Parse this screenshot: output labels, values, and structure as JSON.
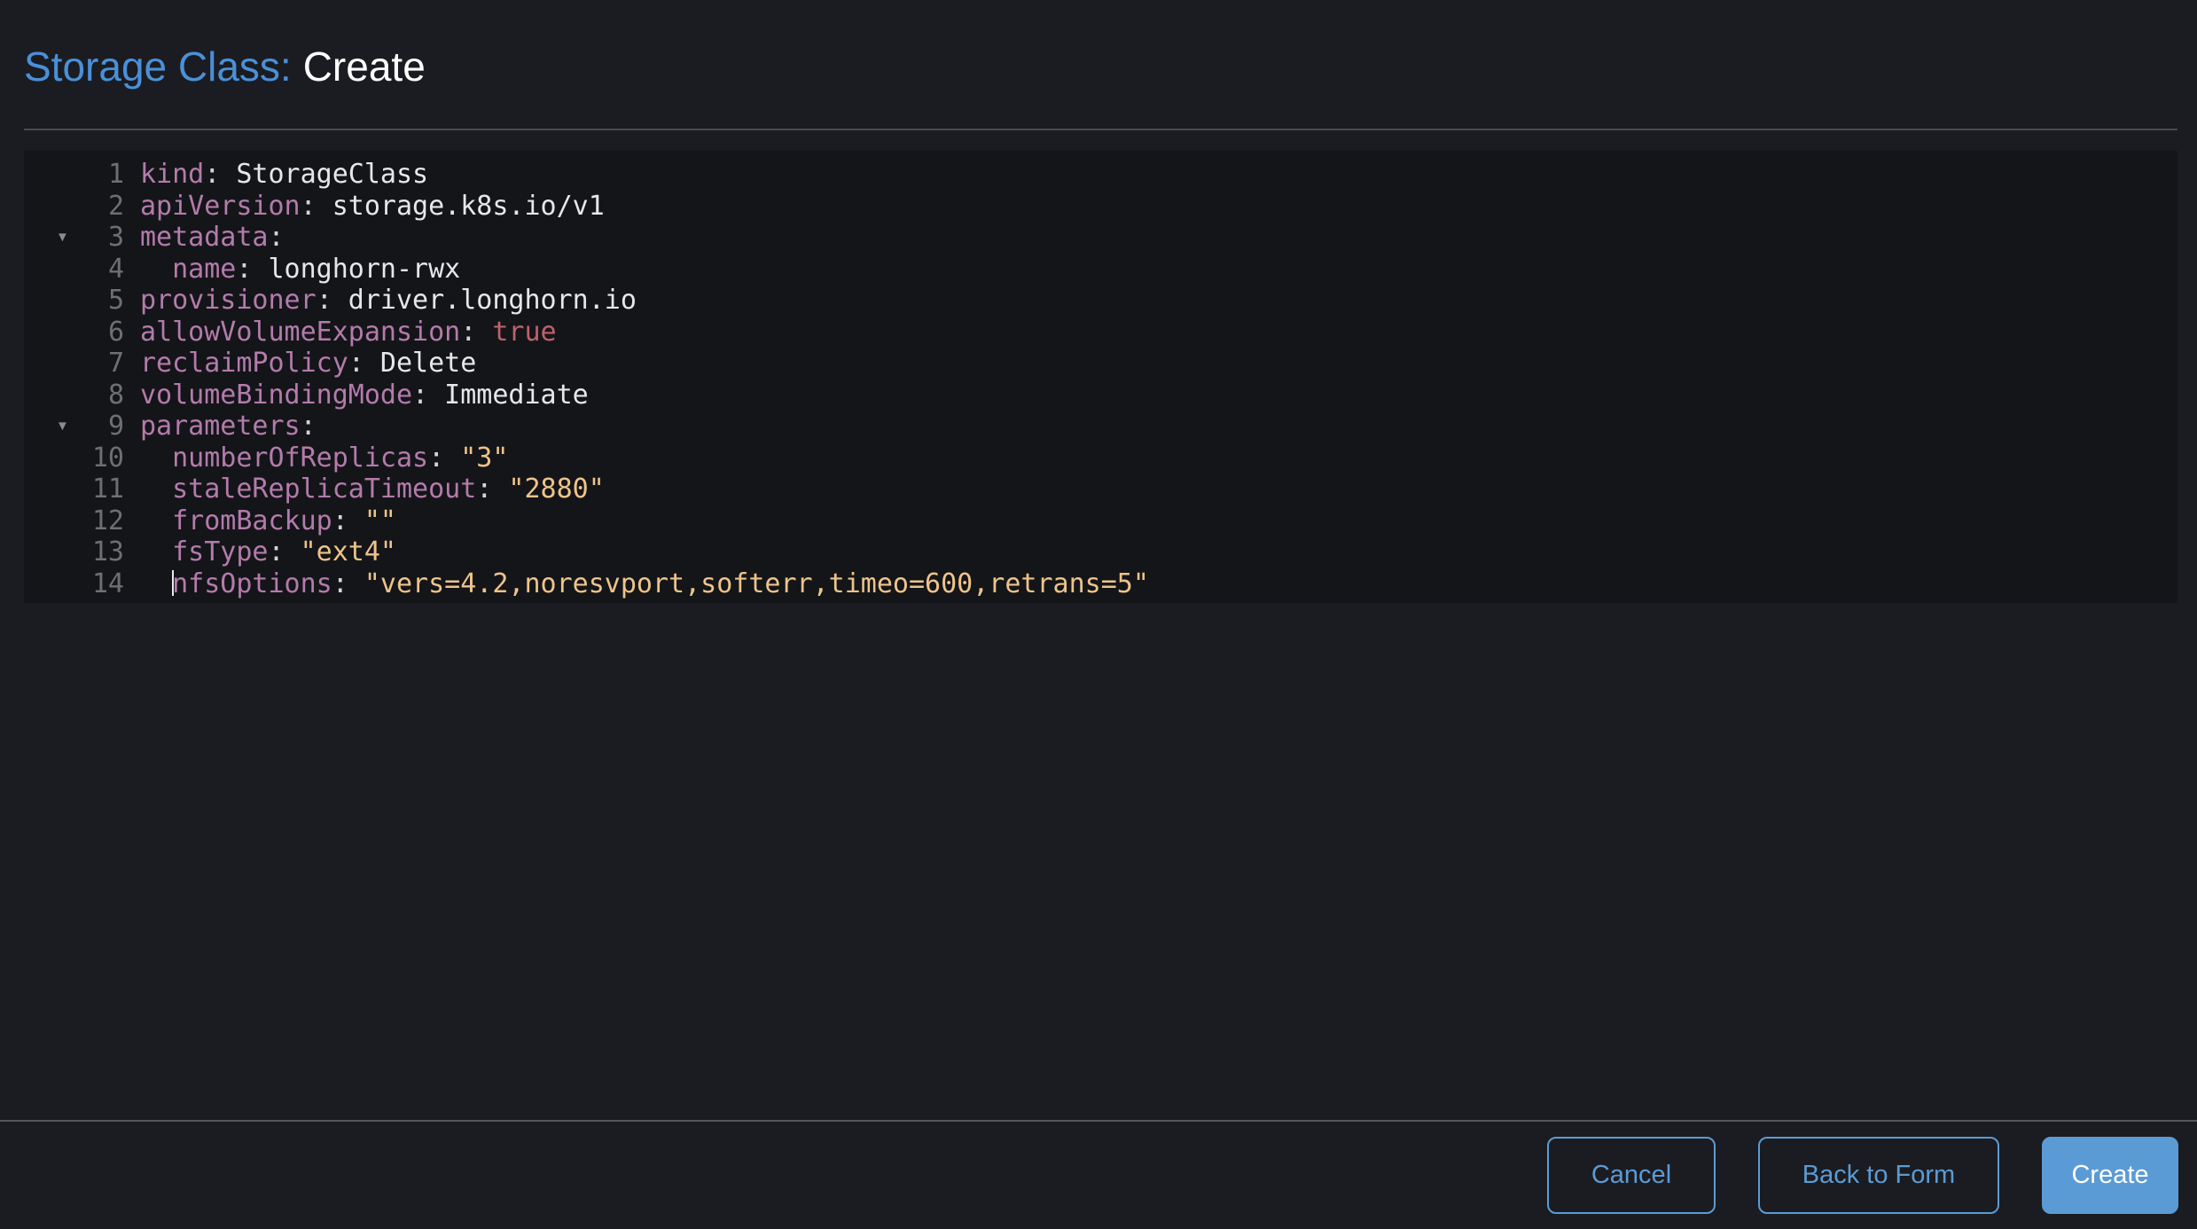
{
  "header": {
    "title_prefix": "Storage Class:",
    "title_action": "Create"
  },
  "colors": {
    "page_bg": "#1b1c21",
    "editor_bg": "#141519",
    "divider_top": "#4a4b50",
    "divider_bottom": "#55565b",
    "title_blue": "#4a90d8",
    "accent_blue": "#5b9bd5",
    "key": "#b37bab",
    "string": "#eec48a",
    "atom": "#bf616a",
    "value": "#e6e7e9",
    "punctuation": "#d4d5d8",
    "line_number": "#6e6f73",
    "fold": "#8a8b8e",
    "cursor": "#e8eaed"
  },
  "editor": {
    "language": "yaml",
    "fold_icon": "▼",
    "lines": [
      {
        "n": "1",
        "fold": false,
        "tokens": [
          [
            "key",
            "kind"
          ],
          [
            "punc",
            ":"
          ],
          [
            "val",
            " StorageClass"
          ]
        ]
      },
      {
        "n": "2",
        "fold": false,
        "tokens": [
          [
            "key",
            "apiVersion"
          ],
          [
            "punc",
            ":"
          ],
          [
            "val",
            " storage.k8s.io/v1"
          ]
        ]
      },
      {
        "n": "3",
        "fold": true,
        "tokens": [
          [
            "key",
            "metadata"
          ],
          [
            "punc",
            ":"
          ]
        ]
      },
      {
        "n": "4",
        "fold": false,
        "tokens": [
          [
            "val",
            "  "
          ],
          [
            "key",
            "name"
          ],
          [
            "punc",
            ":"
          ],
          [
            "val",
            " longhorn-rwx"
          ]
        ]
      },
      {
        "n": "5",
        "fold": false,
        "tokens": [
          [
            "key",
            "provisioner"
          ],
          [
            "punc",
            ":"
          ],
          [
            "val",
            " driver.longhorn.io"
          ]
        ]
      },
      {
        "n": "6",
        "fold": false,
        "tokens": [
          [
            "key",
            "allowVolumeExpansion"
          ],
          [
            "punc",
            ":"
          ],
          [
            "atom",
            " true"
          ]
        ]
      },
      {
        "n": "7",
        "fold": false,
        "tokens": [
          [
            "key",
            "reclaimPolicy"
          ],
          [
            "punc",
            ":"
          ],
          [
            "val",
            " Delete"
          ]
        ]
      },
      {
        "n": "8",
        "fold": false,
        "tokens": [
          [
            "key",
            "volumeBindingMode"
          ],
          [
            "punc",
            ":"
          ],
          [
            "val",
            " Immediate"
          ]
        ]
      },
      {
        "n": "9",
        "fold": true,
        "tokens": [
          [
            "key",
            "parameters"
          ],
          [
            "punc",
            ":"
          ]
        ]
      },
      {
        "n": "10",
        "fold": false,
        "tokens": [
          [
            "val",
            "  "
          ],
          [
            "key",
            "numberOfReplicas"
          ],
          [
            "punc",
            ":"
          ],
          [
            "str",
            " \"3\""
          ]
        ]
      },
      {
        "n": "11",
        "fold": false,
        "tokens": [
          [
            "val",
            "  "
          ],
          [
            "key",
            "staleReplicaTimeout"
          ],
          [
            "punc",
            ":"
          ],
          [
            "str",
            " \"2880\""
          ]
        ]
      },
      {
        "n": "12",
        "fold": false,
        "tokens": [
          [
            "val",
            "  "
          ],
          [
            "key",
            "fromBackup"
          ],
          [
            "punc",
            ":"
          ],
          [
            "str",
            " \"\""
          ]
        ]
      },
      {
        "n": "13",
        "fold": false,
        "tokens": [
          [
            "val",
            "  "
          ],
          [
            "key",
            "fsType"
          ],
          [
            "punc",
            ":"
          ],
          [
            "str",
            " \"ext4\""
          ]
        ]
      },
      {
        "n": "14",
        "fold": false,
        "tokens": [
          [
            "val",
            "  "
          ],
          [
            "cursor",
            ""
          ],
          [
            "key",
            "nfsOptions"
          ],
          [
            "punc",
            ":"
          ],
          [
            "str",
            " \"vers=4.2,noresvport,softerr,timeo=600,retrans=5\""
          ]
        ]
      }
    ]
  },
  "footer": {
    "cancel_label": "Cancel",
    "back_label": "Back to Form",
    "create_label": "Create"
  }
}
